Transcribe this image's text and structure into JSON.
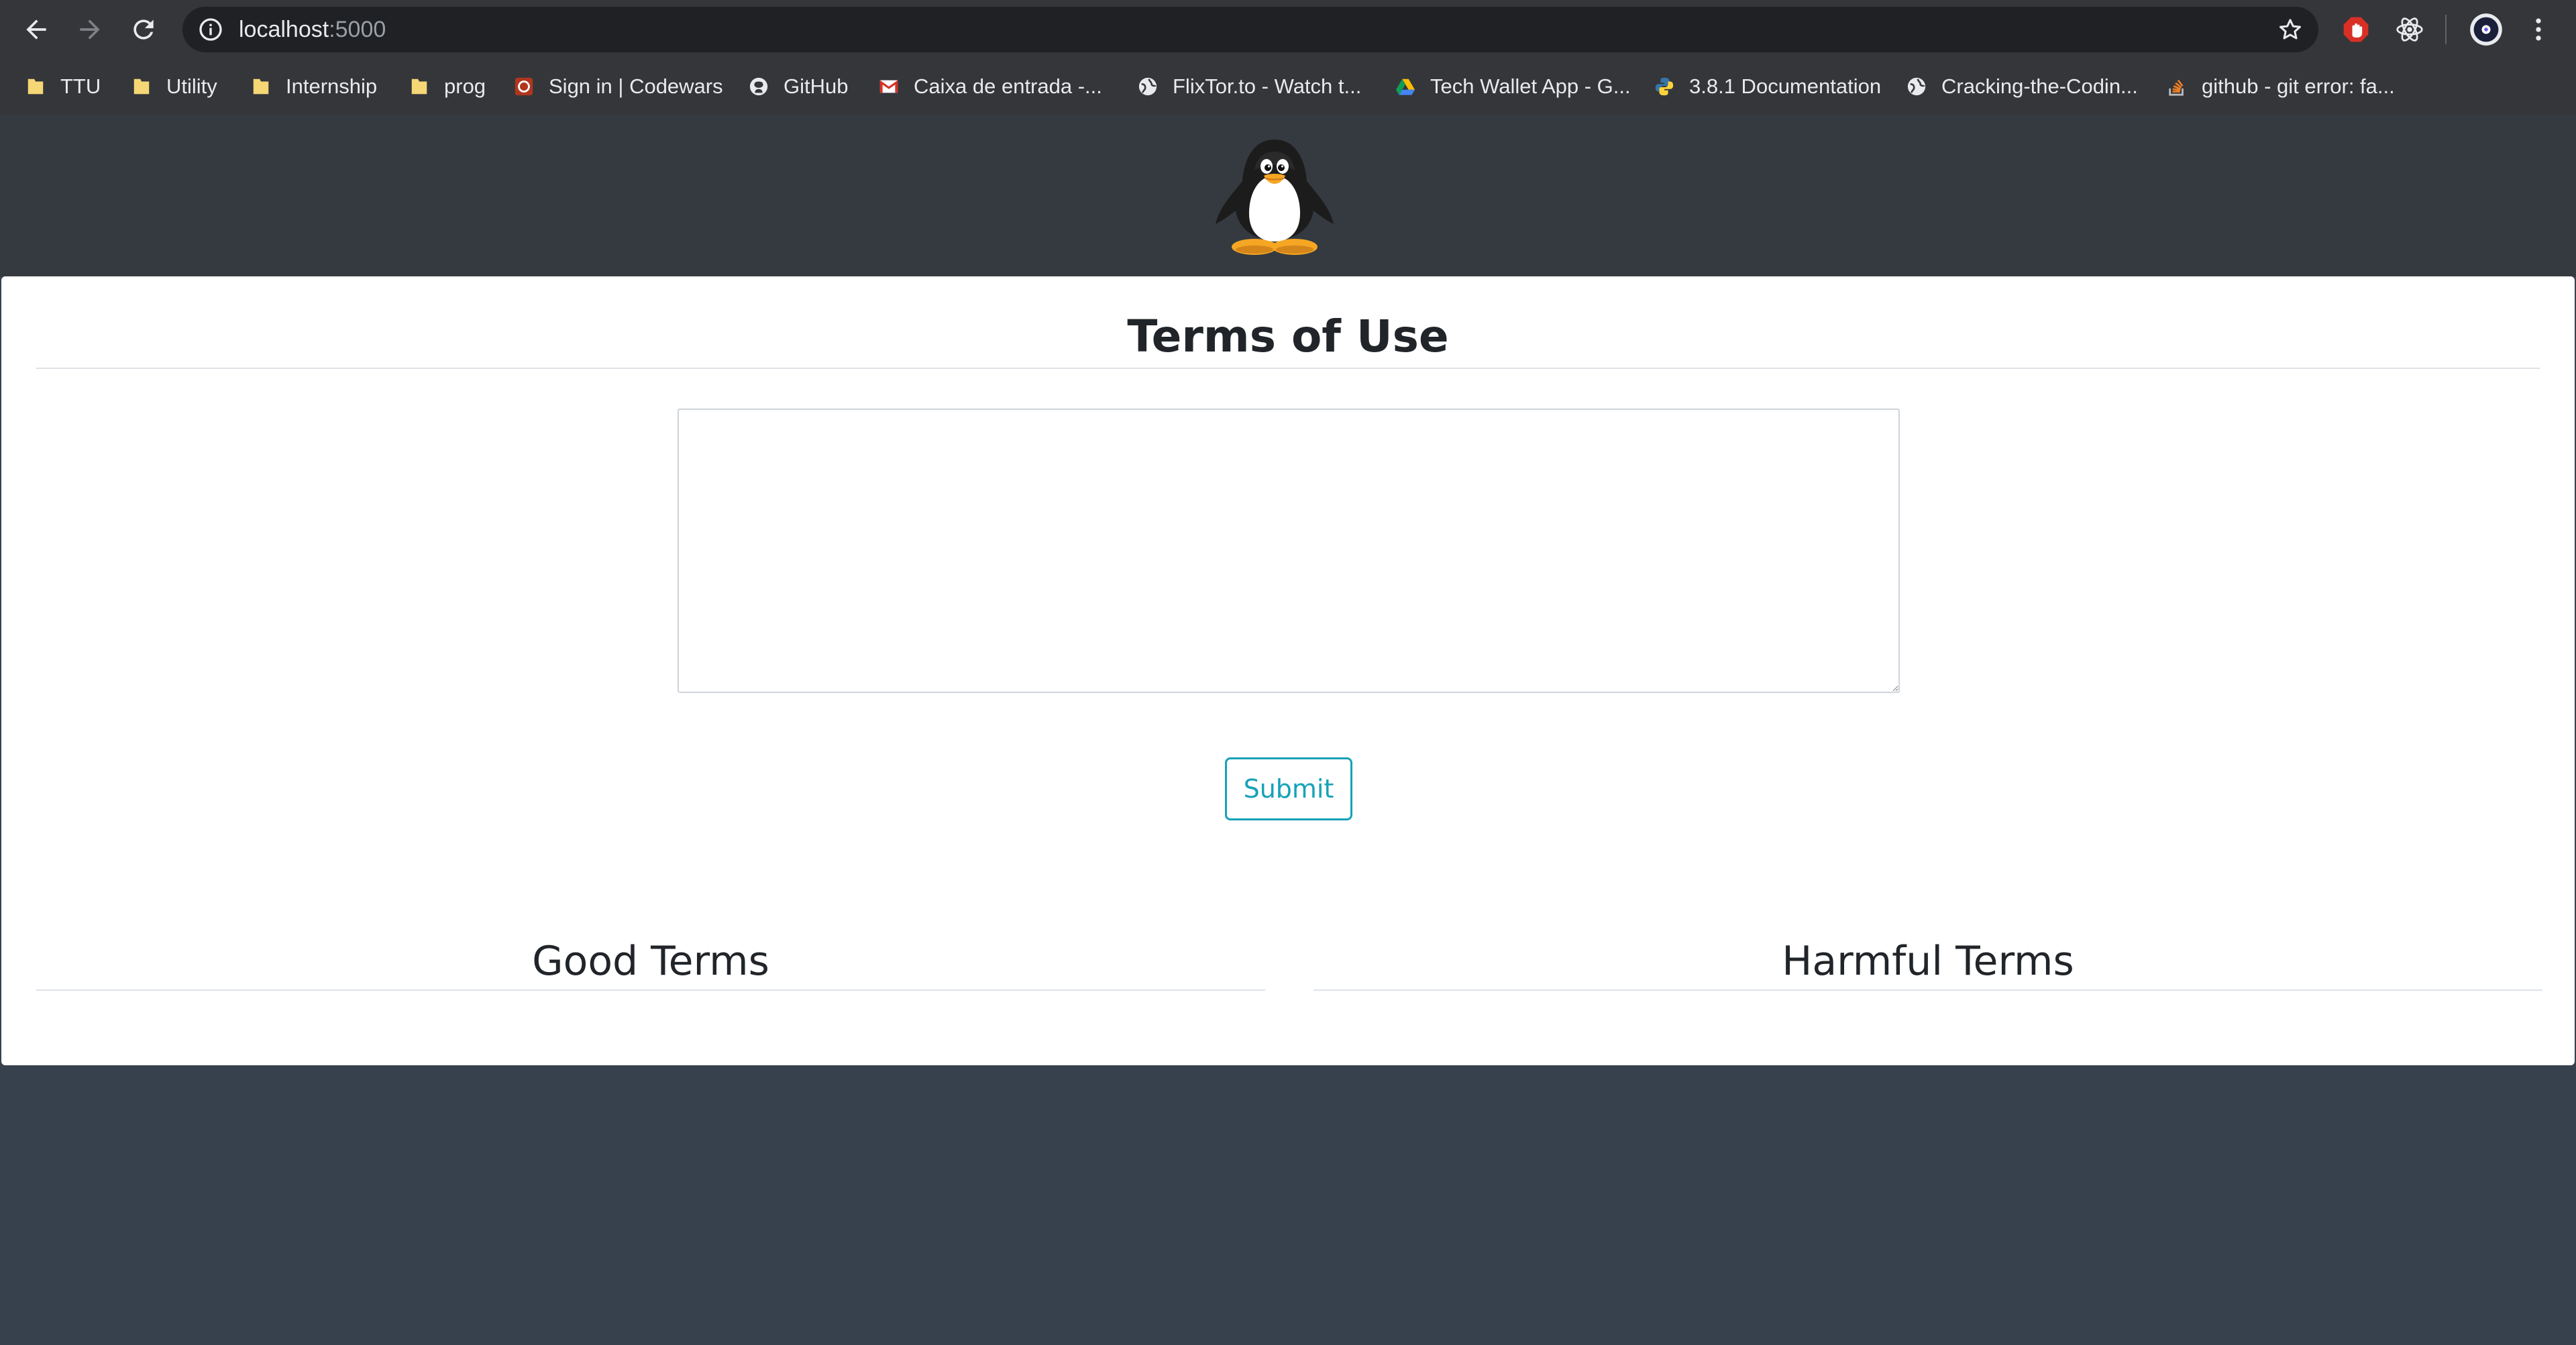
{
  "browser": {
    "url_host": "localhost",
    "url_port": ":5000",
    "bookmarks": [
      {
        "label": "TTU",
        "icon": "folder-icon"
      },
      {
        "label": "Utility",
        "icon": "folder-icon"
      },
      {
        "label": "Internship",
        "icon": "folder-icon"
      },
      {
        "label": "prog",
        "icon": "folder-icon"
      },
      {
        "label": "Sign in | Codewars",
        "icon": "codewars-icon"
      },
      {
        "label": "GitHub",
        "icon": "github-icon"
      },
      {
        "label": "Caixa de entrada -...",
        "icon": "gmail-icon"
      },
      {
        "label": "FlixTor.to - Watch t...",
        "icon": "globe-icon"
      },
      {
        "label": "Tech Wallet App - G...",
        "icon": "google-drive-icon"
      },
      {
        "label": "3.8.1 Documentation",
        "icon": "python-icon"
      },
      {
        "label": "Cracking-the-Codin...",
        "icon": "globe-icon"
      },
      {
        "label": "github - git error: fa...",
        "icon": "stackoverflow-icon"
      }
    ]
  },
  "page": {
    "logo": "penguin-logo",
    "title": "Terms of Use",
    "terms_input": {
      "value": "",
      "placeholder": ""
    },
    "submit_label": "Submit",
    "good_terms_heading": "Good Terms",
    "harmful_terms_heading": "Harmful Terms"
  },
  "colors": {
    "header_bg": "#343a40",
    "page_bg": "#37414e",
    "submit_accent": "#17a2b8"
  }
}
